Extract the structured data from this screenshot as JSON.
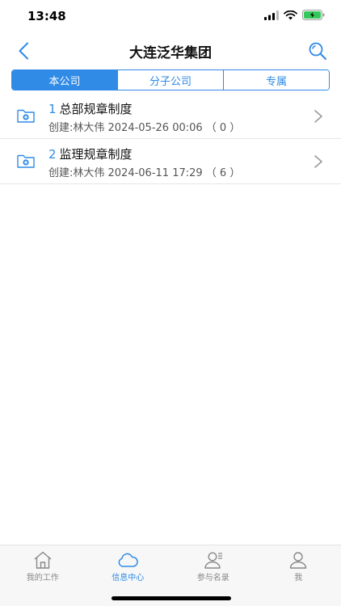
{
  "status": {
    "time": "13:48"
  },
  "nav": {
    "title": "大连泛华集团"
  },
  "tabs": [
    {
      "label": "本公司",
      "active": true
    },
    {
      "label": "分子公司",
      "active": false
    },
    {
      "label": "专属",
      "active": false
    }
  ],
  "list": [
    {
      "number": "1",
      "title": "总部规章制度",
      "subtitle": "创建:林大伟 2024-05-26 00:06 （ 0 ）"
    },
    {
      "number": "2",
      "title": "监理规章制度",
      "subtitle": "创建:林大伟 2024-06-11 17:29 （ 6 ）"
    }
  ],
  "tabbar": [
    {
      "label": "我的工作",
      "icon": "home-icon",
      "active": false
    },
    {
      "label": "信息中心",
      "icon": "cloud-icon",
      "active": true
    },
    {
      "label": "参与名录",
      "icon": "contacts-icon",
      "active": false
    },
    {
      "label": "我",
      "icon": "person-icon",
      "active": false
    }
  ],
  "colors": {
    "accent": "#2f8be6",
    "battery": "#34c759"
  }
}
